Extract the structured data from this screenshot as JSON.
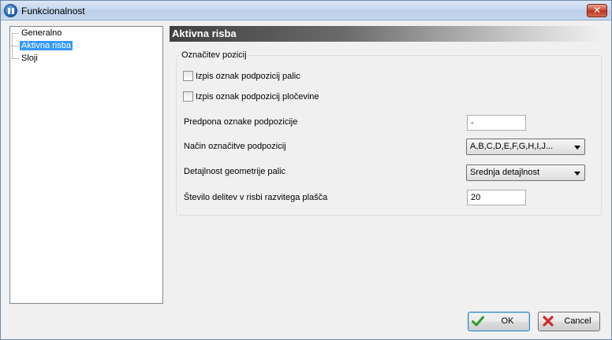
{
  "window": {
    "title": "Funkcionalnost",
    "close_glyph": "✕"
  },
  "tree": {
    "items": [
      {
        "label": "Generalno",
        "selected": false
      },
      {
        "label": "Aktivna risba",
        "selected": true
      },
      {
        "label": "Sloji",
        "selected": false
      }
    ]
  },
  "panel": {
    "header": "Aktivna risba",
    "group_title": "Označitev pozicij",
    "checkboxes": [
      {
        "label": "Izpis oznak podpozicij palic",
        "checked": false
      },
      {
        "label": "Izpis oznak podpozicij pločevine",
        "checked": false
      }
    ],
    "fields": {
      "prefix": {
        "label": "Predpona oznake podpozicije",
        "value": "-"
      },
      "mode": {
        "label": "Način označitve podpozicij",
        "value": "A,B,C,D,E,F,G,H,I,J..."
      },
      "detail": {
        "label": "Detajlnost geometrije palic",
        "value": "Srednja detajlnost"
      },
      "divisions": {
        "label": "Število delitev v risbi razvitega plašča",
        "value": "20"
      }
    }
  },
  "buttons": {
    "ok": "OK",
    "cancel": "Cancel"
  },
  "colors": {
    "selection": "#3399ff",
    "ok_icon": "#2e9b2e",
    "cancel_icon": "#d42a2a"
  }
}
